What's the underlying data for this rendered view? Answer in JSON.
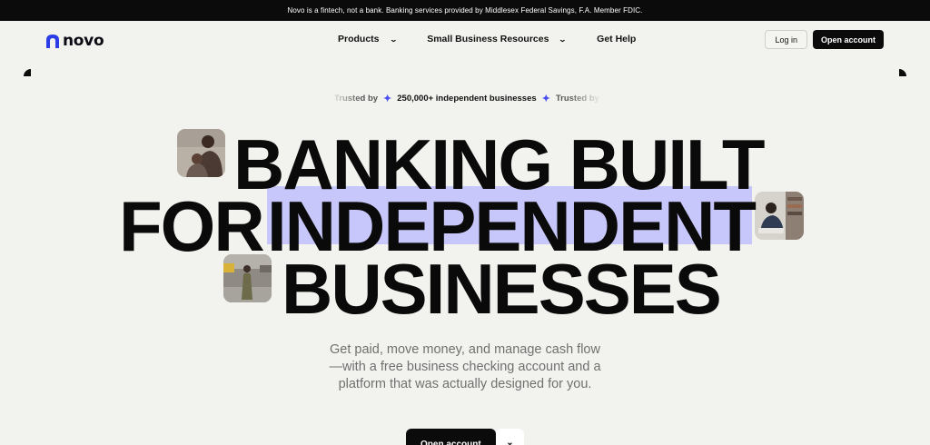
{
  "banner": {
    "text": "Novo is a fintech, not a bank. Banking services provided by Middlesex Federal Savings, F.A. Member FDIC."
  },
  "brand": {
    "name": "novo",
    "accent": "#2b3de8"
  },
  "nav": {
    "items": [
      {
        "label": "Products",
        "icon": "chevron-down-icon"
      },
      {
        "label": "Small Business Resources",
        "icon": "chevron-down-icon"
      },
      {
        "label": "Get Help"
      }
    ],
    "login_label": "Log in",
    "open_account_label": "Open account"
  },
  "trusted": {
    "lead": "Trusted by",
    "count": "250,000+ independent businesses",
    "tail": "Trusted by",
    "icon": "sparkle-icon",
    "icon_color": "#4a4df0"
  },
  "hero": {
    "line1": "BANKING BUILT",
    "line2_prefix": "FOR",
    "line2_highlight": "INDEPENDENT",
    "line3": "BUSINESSES",
    "highlight_color": "#c7c7fb"
  },
  "subtext": {
    "line1": "Get paid, move money, and manage cash flow",
    "line2": "—with a free business checking account and a",
    "line3": "platform that was actually designed for you."
  },
  "cta": {
    "primary_label": "Open account",
    "secondary_icon": "chevron-down-icon"
  }
}
